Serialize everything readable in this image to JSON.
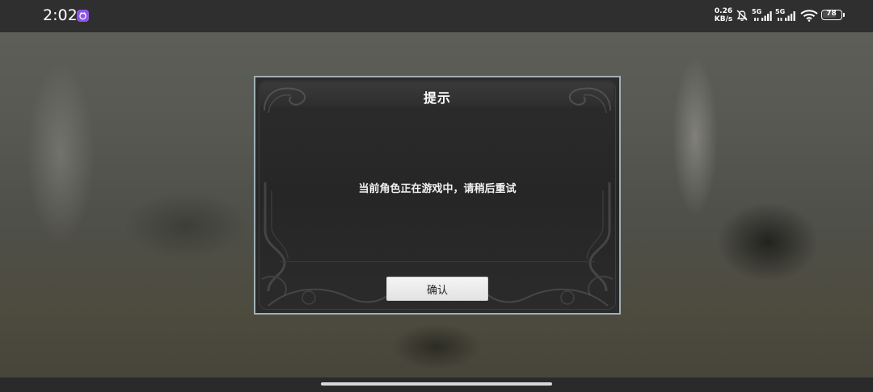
{
  "status_bar": {
    "time": "2:02",
    "app_icon": "purple-app-icon",
    "net_speed_value": "0.26",
    "net_speed_unit": "KB/s",
    "signal_1_label": "5G",
    "signal_2_label": "5G",
    "battery_level": "78",
    "battery_fraction": 0.78
  },
  "dialog": {
    "title": "提示",
    "message": "当前角色正在游戏中，请稍后重试",
    "confirm_label": "确认"
  },
  "colors": {
    "dialog_border": "#9fb0b4",
    "dialog_bg": "#2a2a2a",
    "button_bg": "#efefef",
    "accent_purple": "#8d55e8"
  }
}
